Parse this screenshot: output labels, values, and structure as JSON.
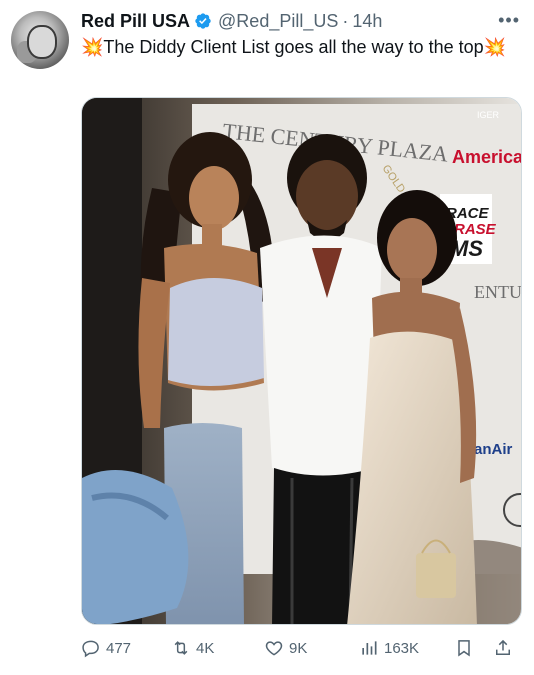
{
  "author": {
    "name": "Red Pill USA",
    "handle": "@Red_Pill_US",
    "separator": "·",
    "time": "14h"
  },
  "tweet": {
    "text": "💥The Diddy Client List goes all the way to the top💥"
  },
  "photo": {
    "signage": {
      "venue": "THE CENTURY PLAZA",
      "arc_text": "GOLD MEMES GRAND",
      "america": "America",
      "race_line1": "RACE",
      "race_line2": "ERASE",
      "race_line3": "MS",
      "century_side": "ENTUR",
      "airline": "anAir",
      "corner_logo": "IGER"
    }
  },
  "metrics": {
    "replies": "477",
    "retweets": "4K",
    "likes": "9K",
    "views": "163K"
  },
  "colors": {
    "verified": "#1d9bf0",
    "muted": "#536471",
    "text": "#0f1419"
  }
}
